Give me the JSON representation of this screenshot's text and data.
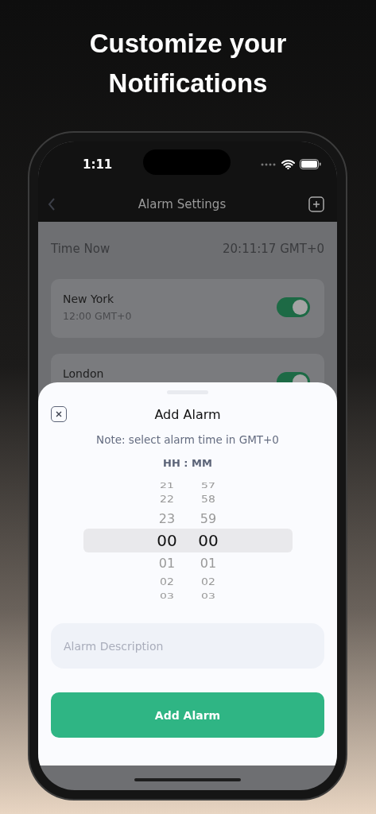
{
  "headline": "Customize your Notifications",
  "status_bar": {
    "time": "1:11"
  },
  "nav": {
    "title": "Alarm Settings"
  },
  "time_now": {
    "label": "Time Now",
    "value": "20:11:17 GMT+0"
  },
  "alarms": [
    {
      "city": "New York",
      "time": "12:00 GMT+0",
      "on": true
    },
    {
      "city": "London",
      "on": true
    }
  ],
  "sheet": {
    "title": "Add Alarm",
    "note": "Note: select alarm time in GMT+0",
    "picker_label": "HH : MM",
    "rows": [
      {
        "hour": "21",
        "minute": "57",
        "selected": false
      },
      {
        "hour": "22",
        "minute": "58",
        "selected": false
      },
      {
        "hour": "23",
        "minute": "59",
        "selected": false
      },
      {
        "hour": "00",
        "minute": "00",
        "selected": true
      },
      {
        "hour": "01",
        "minute": "01",
        "selected": false
      },
      {
        "hour": "02",
        "minute": "02",
        "selected": false
      },
      {
        "hour": "03",
        "minute": "03",
        "selected": false
      }
    ],
    "description": {
      "placeholder": "Alarm Description"
    },
    "button": "Add Alarm"
  }
}
